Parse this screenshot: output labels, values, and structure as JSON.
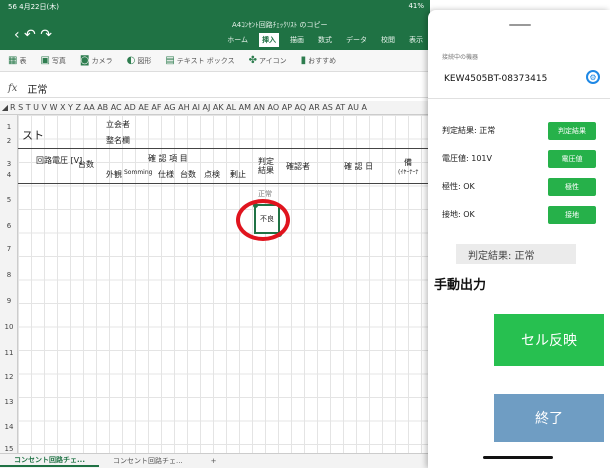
{
  "status_bar": {
    "time_date": "56 4月22日(木)",
    "battery": "41%"
  },
  "excel": {
    "doc_title": "A4ｺﾝｾﾝﾄ回路ﾁｪｯｸﾘｽﾄ のコピー",
    "ribbon_tabs": [
      "ホーム",
      "挿入",
      "描画",
      "数式",
      "データ",
      "校閲",
      "表示"
    ],
    "active_tab": "挿入",
    "toolbar": [
      "表",
      "写真",
      "カメラ",
      "図形",
      "テキスト ボックス",
      "アイコン",
      "おすすめ"
    ],
    "formula_value": "正常",
    "column_headers": "R S T U V W X Y Z AA AB AC AD AE AF AG AH AI AJ AK AL AM AN AO AP AQ AR AS AT AU A",
    "rows": [
      "1",
      "2",
      "3",
      "4",
      "5",
      "6",
      "7",
      "8",
      "9",
      "10",
      "11",
      "12",
      "13",
      "14",
      "15"
    ],
    "cells": {
      "r1_text": "スト",
      "witness": "立会者",
      "organizer": "整名欄",
      "circuit_voltage": "回路電圧 [V]",
      "count": "台数",
      "inspection_header": "確 認 項 目",
      "appearance": "外観",
      "insulation": "Somming",
      "spec": "仕様",
      "count2": "台数",
      "tag": "点検",
      "other": "剰止",
      "judgment": "判定 結果",
      "inspector": "確認者",
      "date": "確 認 日",
      "remark": "備",
      "remark2": "(ｲﾔｰﾅｰﾅ",
      "ok": "正常",
      "ng": "不良"
    },
    "sheet_tabs": [
      "コンセント回路チェ...",
      "コンセント回路チェ...",
      "+"
    ]
  },
  "panel": {
    "connected_label": "接続中の機器",
    "device_name": "KEW4505BT-08373415",
    "rows": [
      {
        "label": "判定結果: 正常",
        "button": "判定結果"
      },
      {
        "label": "電圧値: 101V",
        "button": "電圧値"
      },
      {
        "label": "極性: OK",
        "button": "極性"
      },
      {
        "label": "接地: OK",
        "button": "接地"
      }
    ],
    "result_box": "判定結果: 正常",
    "manual_output": "手動出力",
    "cell_reflect": "セル反映",
    "finish": "終了"
  }
}
